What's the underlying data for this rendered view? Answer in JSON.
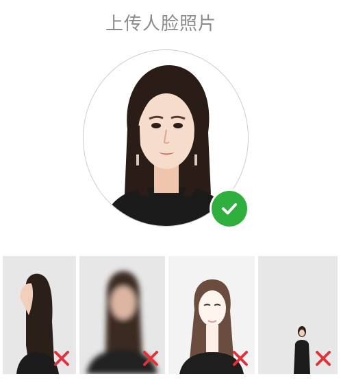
{
  "header": {
    "title": "上传人脸照片"
  },
  "upload": {
    "status_icon": "check-icon",
    "status_color": "#2eaf3e"
  },
  "examples": [
    {
      "name": "side-profile-example",
      "icon": "cross-icon"
    },
    {
      "name": "blurry-example",
      "icon": "cross-icon"
    },
    {
      "name": "bright-example",
      "icon": "cross-icon"
    },
    {
      "name": "too-far-example",
      "icon": "cross-icon"
    }
  ],
  "colors": {
    "title": "#8b8b8b",
    "accent_ok": "#2eaf3e",
    "reject": "#e0323a"
  }
}
